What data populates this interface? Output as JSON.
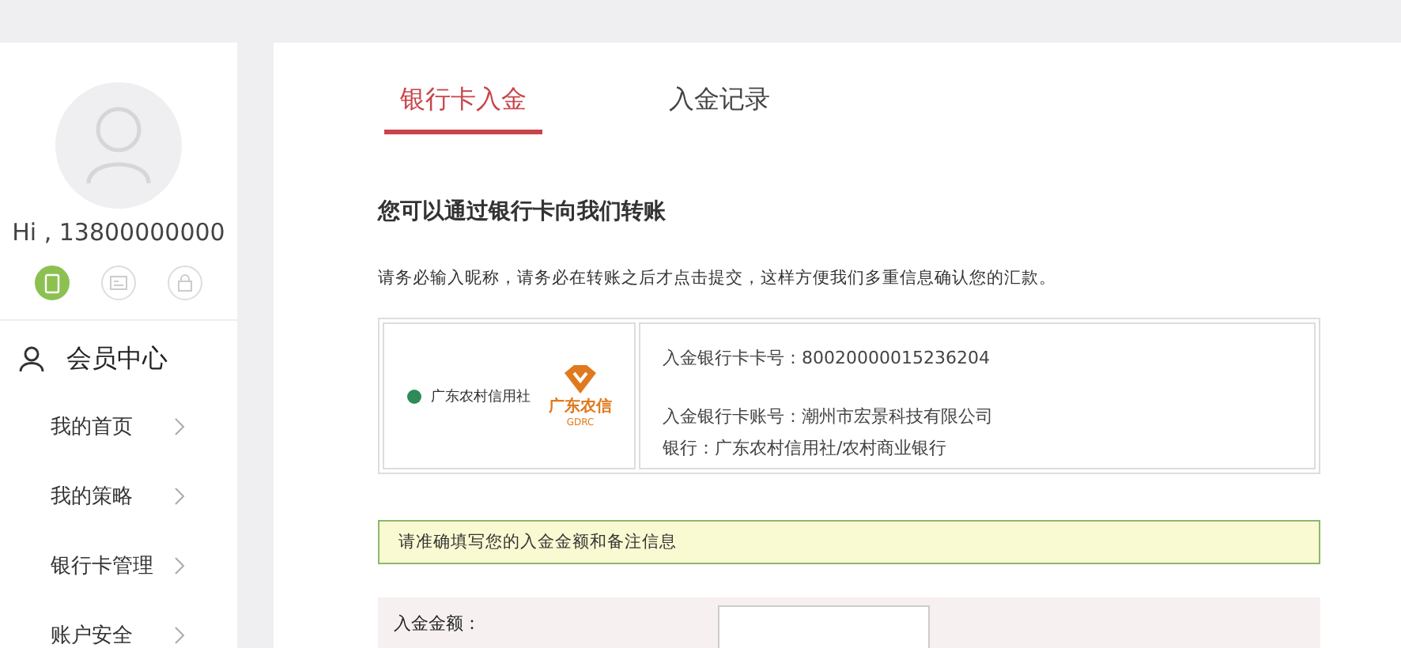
{
  "sidebar": {
    "greeting": "Hi , 13800000000",
    "badges": [
      {
        "kind": "phone",
        "verified": true
      },
      {
        "kind": "id-card",
        "verified": false
      },
      {
        "kind": "lock",
        "verified": false
      }
    ],
    "section_title": "会员中心",
    "items": [
      {
        "label": "我的首页"
      },
      {
        "label": "我的策略"
      },
      {
        "label": "银行卡管理"
      },
      {
        "label": "账户安全"
      }
    ]
  },
  "tabs": [
    {
      "label": "银行卡入金",
      "selected": true
    },
    {
      "label": "入金记录",
      "selected": false
    }
  ],
  "heading": "您可以通过银行卡向我们转账",
  "notice": "请务必输入昵称，请务必在转账之后才点击提交，这样方便我们多重信息确认您的汇款。",
  "bank": {
    "logo_text": "广东农村信用社",
    "brand_text": "广东农信",
    "brand_sub": "GDRC",
    "lines": [
      "入金银行卡卡号：80020000015236204",
      "入金银行卡账号：潮州市宏景科技有限公司",
      "银行：广东农村信用社/农村商业银行"
    ]
  },
  "alert": "请准确填写您的入金金额和备注信息",
  "form": {
    "amount_label": "入金金额："
  }
}
